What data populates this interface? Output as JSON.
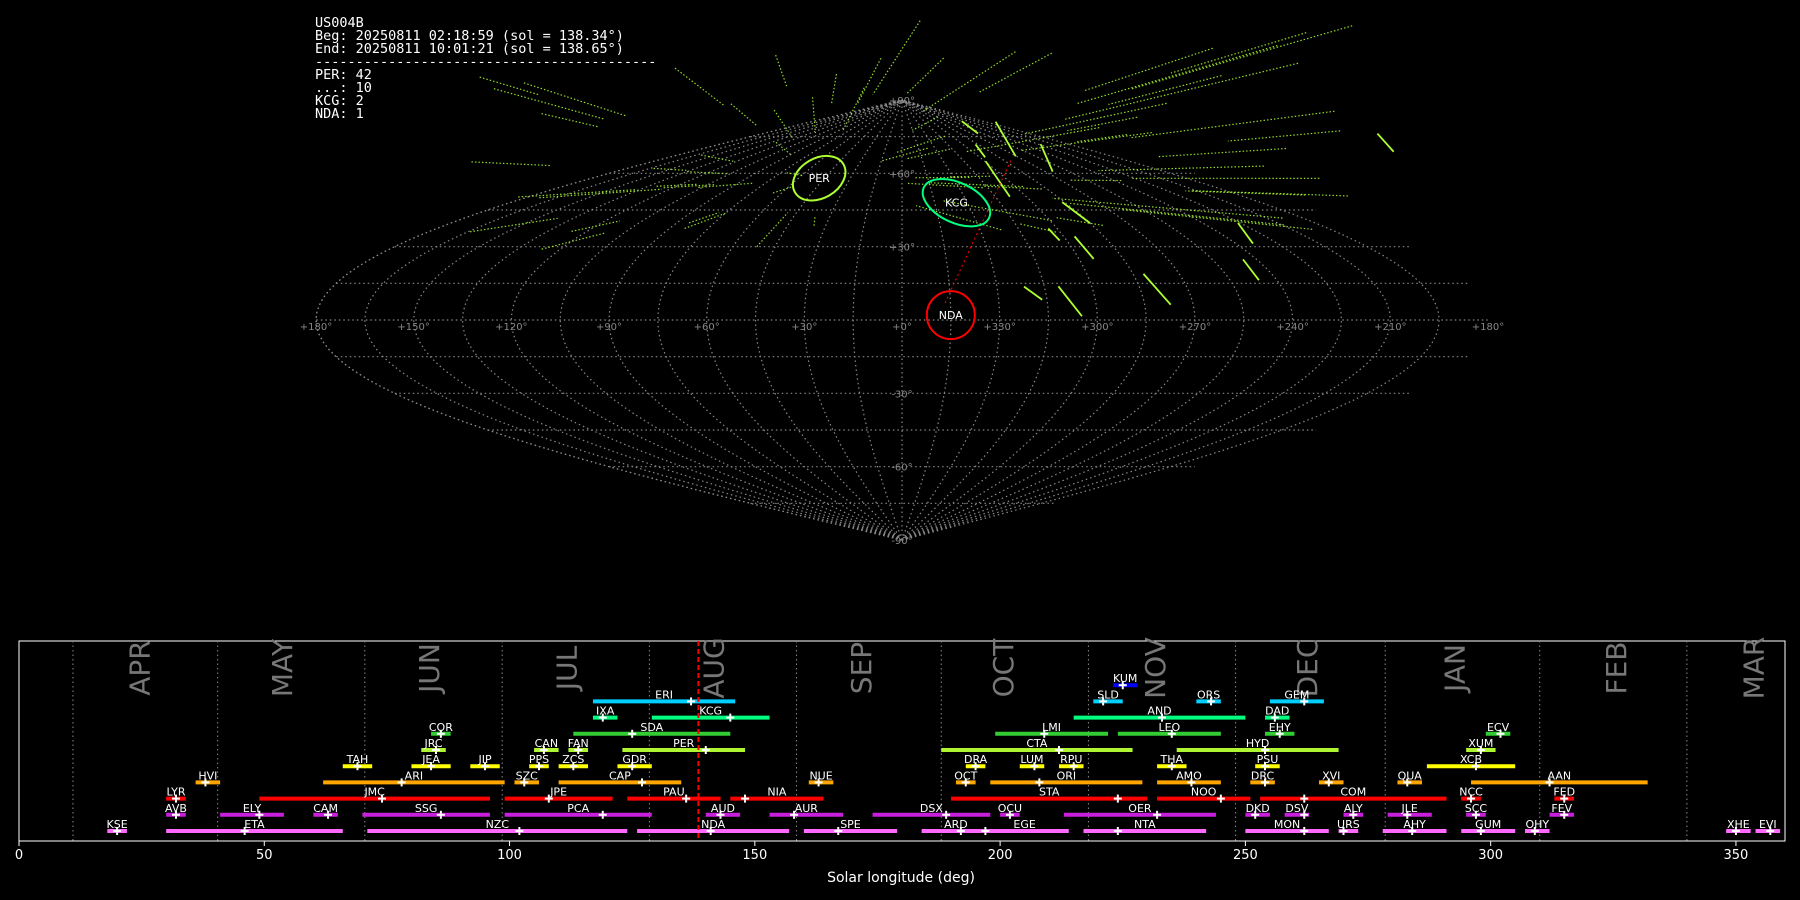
{
  "info": {
    "station": "US004B",
    "beg": "Beg: 20250811 02:18:59 (sol = 138.34°)",
    "end": "End: 20250811 10:01:21 (sol = 138.65°)",
    "separator": "------------------------------------------",
    "counts": [
      "PER: 42",
      "...: 10",
      "KCG: 2",
      "NDA: 1"
    ]
  },
  "colors": {
    "red": "#ff0000",
    "orange": "#ffa500",
    "yellow": "#ffff00",
    "yellowgreen": "#aef532",
    "green": "#32cd32",
    "springgreen": "#00ff7f",
    "cyan": "#00d0ff",
    "blue": "#0000ff",
    "purple": "#c71fdb",
    "pink": "#ff69ff",
    "violet": "#ee82ee",
    "grid": "#888888",
    "track": "#adff2f",
    "month_text": "#777777"
  },
  "chart_data": [
    {
      "type": "scatter",
      "projection": "sinusoidal",
      "lon_ticks": [
        180,
        150,
        120,
        90,
        60,
        30,
        0,
        330,
        300,
        270,
        240,
        210,
        180
      ],
      "lat_ticks": [
        90,
        60,
        30,
        -30,
        -60,
        -90
      ],
      "lon_tick_labels": [
        "+180°",
        "+150°",
        "+120°",
        "+90°",
        "+60°",
        "+30°",
        "+0°",
        "+330°",
        "+300°",
        "+270°",
        "+240°",
        "+210°",
        "+180°"
      ],
      "lat_tick_labels": [
        "+90°",
        "+60°",
        "+30°",
        "-30°",
        "-60°",
        "-90°"
      ],
      "radiants": [
        {
          "name": "PER",
          "lon": 48,
          "lat": 58,
          "color": "#adff2f"
        },
        {
          "name": "KCG",
          "lon": 335,
          "lat": 48,
          "color": "#00ff7f"
        },
        {
          "name": "NDA",
          "lon": 345,
          "lat": 2,
          "color": "#ff0000"
        }
      ]
    },
    {
      "type": "timeline",
      "xlabel": "Solar longitude (deg)",
      "xlim": [
        0,
        360
      ],
      "xticks": [
        0,
        50,
        100,
        150,
        200,
        250,
        300,
        350
      ],
      "current_sol": 138.5,
      "month_boundaries": [
        11,
        40.5,
        70.5,
        98.5,
        128.5,
        158.5,
        188,
        218,
        248,
        278.5,
        310,
        340
      ],
      "months": [
        {
          "name": "APR",
          "center": 25
        },
        {
          "name": "MAY",
          "center": 54
        },
        {
          "name": "JUN",
          "center": 84
        },
        {
          "name": "JUL",
          "center": 112
        },
        {
          "name": "AUG",
          "center": 142
        },
        {
          "name": "SEP",
          "center": 172
        },
        {
          "name": "OCT",
          "center": 201
        },
        {
          "name": "NOV",
          "center": 232
        },
        {
          "name": "DEC",
          "center": 263
        },
        {
          "name": "JAN",
          "center": 293
        },
        {
          "name": "FEB",
          "center": 326
        },
        {
          "name": "MAR",
          "center": 354
        }
      ],
      "showers": [
        {
          "code": "KUM",
          "row": 9,
          "start": 223,
          "end": 228,
          "peak": 225,
          "color": "blue"
        },
        {
          "code": "ERI",
          "row": 8,
          "start": 117,
          "end": 146,
          "peak": 137,
          "color": "cyan"
        },
        {
          "code": "SLD",
          "row": 8,
          "start": 219,
          "end": 225,
          "peak": 221,
          "color": "cyan"
        },
        {
          "code": "ORS",
          "row": 8,
          "start": 240,
          "end": 245,
          "peak": 243,
          "color": "cyan"
        },
        {
          "code": "GEM",
          "row": 8,
          "start": 255,
          "end": 266,
          "peak": 262,
          "color": "cyan"
        },
        {
          "code": "IXA",
          "row": 7,
          "start": 117,
          "end": 122,
          "peak": 119,
          "color": "springgreen"
        },
        {
          "code": "KCG",
          "row": 7,
          "start": 129,
          "end": 153,
          "peak": 145,
          "color": "springgreen"
        },
        {
          "code": "AND",
          "row": 7,
          "start": 215,
          "end": 250,
          "peak": 233,
          "color": "springgreen"
        },
        {
          "code": "DAD",
          "row": 7,
          "start": 254,
          "end": 259,
          "peak": 256,
          "color": "springgreen"
        },
        {
          "code": "COR",
          "row": 6,
          "start": 84,
          "end": 88,
          "peak": 86,
          "color": "green"
        },
        {
          "code": "SDA",
          "row": 6,
          "start": 113,
          "end": 145,
          "peak": 125,
          "color": "green"
        },
        {
          "code": "LMI",
          "row": 6,
          "start": 199,
          "end": 222,
          "peak": 209,
          "color": "green"
        },
        {
          "code": "LEO",
          "row": 6,
          "start": 224,
          "end": 245,
          "peak": 235,
          "color": "green"
        },
        {
          "code": "EHY",
          "row": 6,
          "start": 254,
          "end": 260,
          "peak": 257,
          "color": "green"
        },
        {
          "code": "ECV",
          "row": 6,
          "start": 299,
          "end": 304,
          "peak": 302,
          "color": "green"
        },
        {
          "code": "JRC",
          "row": 5,
          "start": 82,
          "end": 87,
          "peak": 85,
          "color": "yellowgreen"
        },
        {
          "code": "CAN",
          "row": 5,
          "start": 105,
          "end": 110,
          "peak": 107,
          "color": "yellowgreen"
        },
        {
          "code": "FAN",
          "row": 5,
          "start": 112,
          "end": 116,
          "peak": 114,
          "color": "yellowgreen"
        },
        {
          "code": "PER",
          "row": 5,
          "start": 123,
          "end": 148,
          "peak": 140,
          "color": "yellowgreen"
        },
        {
          "code": "CTA",
          "row": 5,
          "start": 188,
          "end": 227,
          "peak": 212,
          "color": "yellowgreen"
        },
        {
          "code": "HYD",
          "row": 5,
          "start": 236,
          "end": 269,
          "peak": 254,
          "color": "yellowgreen"
        },
        {
          "code": "XUM",
          "row": 5,
          "start": 295,
          "end": 301,
          "peak": 298,
          "color": "yellowgreen"
        },
        {
          "code": "TAH",
          "row": 4,
          "start": 66,
          "end": 72,
          "peak": 69,
          "color": "yellow"
        },
        {
          "code": "JEA",
          "row": 4,
          "start": 80,
          "end": 88,
          "peak": 84,
          "color": "yellow"
        },
        {
          "code": "JIP",
          "row": 4,
          "start": 92,
          "end": 98,
          "peak": 95,
          "color": "yellow"
        },
        {
          "code": "PPS",
          "row": 4,
          "start": 104,
          "end": 108,
          "peak": 106,
          "color": "yellow"
        },
        {
          "code": "ZCS",
          "row": 4,
          "start": 110,
          "end": 116,
          "peak": 113,
          "color": "yellow"
        },
        {
          "code": "GDR",
          "row": 4,
          "start": 122,
          "end": 129,
          "peak": 125,
          "color": "yellow"
        },
        {
          "code": "DRA",
          "row": 4,
          "start": 193,
          "end": 197,
          "peak": 195,
          "color": "yellow"
        },
        {
          "code": "LUM",
          "row": 4,
          "start": 204,
          "end": 209,
          "peak": 207,
          "color": "yellow"
        },
        {
          "code": "RPU",
          "row": 4,
          "start": 212,
          "end": 217,
          "peak": 215,
          "color": "yellow"
        },
        {
          "code": "THA",
          "row": 4,
          "start": 232,
          "end": 238,
          "peak": 235,
          "color": "yellow"
        },
        {
          "code": "PSU",
          "row": 4,
          "start": 252,
          "end": 257,
          "peak": 254,
          "color": "yellow"
        },
        {
          "code": "XCB",
          "row": 4,
          "start": 287,
          "end": 305,
          "peak": 297,
          "color": "yellow"
        },
        {
          "code": "HVI",
          "row": 3,
          "start": 36,
          "end": 41,
          "peak": 38,
          "color": "orange"
        },
        {
          "code": "ARI",
          "row": 3,
          "start": 62,
          "end": 99,
          "peak": 78,
          "color": "orange"
        },
        {
          "code": "SZC",
          "row": 3,
          "start": 101,
          "end": 106,
          "peak": 103,
          "color": "orange"
        },
        {
          "code": "CAP",
          "row": 3,
          "start": 110,
          "end": 135,
          "peak": 127,
          "color": "orange"
        },
        {
          "code": "NUE",
          "row": 3,
          "start": 161,
          "end": 166,
          "peak": 163,
          "color": "orange"
        },
        {
          "code": "OCT",
          "row": 3,
          "start": 191,
          "end": 195,
          "peak": 193,
          "color": "orange"
        },
        {
          "code": "ORI",
          "row": 3,
          "start": 198,
          "end": 229,
          "peak": 208,
          "color": "orange"
        },
        {
          "code": "AMO",
          "row": 3,
          "start": 232,
          "end": 245,
          "peak": 239,
          "color": "orange"
        },
        {
          "code": "DRC",
          "row": 3,
          "start": 251,
          "end": 256,
          "peak": 254,
          "color": "orange"
        },
        {
          "code": "XVI",
          "row": 3,
          "start": 265,
          "end": 270,
          "peak": 267,
          "color": "orange"
        },
        {
          "code": "QUA",
          "row": 3,
          "start": 281,
          "end": 286,
          "peak": 283,
          "color": "orange"
        },
        {
          "code": "AAN",
          "row": 3,
          "start": 296,
          "end": 332,
          "peak": 312,
          "color": "orange"
        },
        {
          "code": "LYR",
          "row": 2,
          "start": 30,
          "end": 34,
          "peak": 32,
          "color": "red"
        },
        {
          "code": "JMC",
          "row": 2,
          "start": 49,
          "end": 96,
          "peak": 74,
          "color": "red"
        },
        {
          "code": "JPE",
          "row": 2,
          "start": 99,
          "end": 121,
          "peak": 108,
          "color": "red"
        },
        {
          "code": "PAU",
          "row": 2,
          "start": 124,
          "end": 143,
          "peak": 136,
          "color": "red"
        },
        {
          "code": "NIA",
          "row": 2,
          "start": 145,
          "end": 164,
          "peak": 148,
          "color": "red"
        },
        {
          "code": "STA",
          "row": 2,
          "start": 190,
          "end": 230,
          "peak": 224,
          "color": "red"
        },
        {
          "code": "NOO",
          "row": 2,
          "start": 232,
          "end": 251,
          "peak": 245,
          "color": "red"
        },
        {
          "code": "COM",
          "row": 2,
          "start": 253,
          "end": 291,
          "peak": 262,
          "color": "red"
        },
        {
          "code": "NCC",
          "row": 2,
          "start": 294,
          "end": 298,
          "peak": 296,
          "color": "red"
        },
        {
          "code": "FED",
          "row": 2,
          "start": 313,
          "end": 317,
          "peak": 315,
          "color": "red"
        },
        {
          "code": "AVB",
          "row": 1,
          "start": 30,
          "end": 34,
          "peak": 32,
          "color": "purple"
        },
        {
          "code": "ELY",
          "row": 1,
          "start": 41,
          "end": 54,
          "peak": 49,
          "color": "purple"
        },
        {
          "code": "CAM",
          "row": 1,
          "start": 60,
          "end": 65,
          "peak": 63,
          "color": "purple"
        },
        {
          "code": "SSG",
          "row": 1,
          "start": 70,
          "end": 96,
          "peak": 86,
          "color": "purple"
        },
        {
          "code": "PCA",
          "row": 1,
          "start": 99,
          "end": 129,
          "peak": 119,
          "color": "purple"
        },
        {
          "code": "AUD",
          "row": 1,
          "start": 140,
          "end": 147,
          "peak": 143,
          "color": "purple"
        },
        {
          "code": "AUR",
          "row": 1,
          "start": 153,
          "end": 168,
          "peak": 158,
          "color": "purple"
        },
        {
          "code": "DSX",
          "row": 1,
          "start": 174,
          "end": 198,
          "peak": 189,
          "color": "purple"
        },
        {
          "code": "OCU",
          "row": 1,
          "start": 200,
          "end": 204,
          "peak": 202,
          "color": "purple"
        },
        {
          "code": "OER",
          "row": 1,
          "start": 213,
          "end": 244,
          "peak": 232,
          "color": "purple"
        },
        {
          "code": "DKD",
          "row": 1,
          "start": 250,
          "end": 255,
          "peak": 252,
          "color": "purple"
        },
        {
          "code": "DSV",
          "row": 1,
          "start": 258,
          "end": 263,
          "peak": 262,
          "color": "purple"
        },
        {
          "code": "ALY",
          "row": 1,
          "start": 270,
          "end": 274,
          "peak": 272,
          "color": "purple"
        },
        {
          "code": "JLE",
          "row": 1,
          "start": 279,
          "end": 288,
          "peak": 283,
          "color": "purple"
        },
        {
          "code": "SCC",
          "row": 1,
          "start": 295,
          "end": 299,
          "peak": 297,
          "color": "purple"
        },
        {
          "code": "FEV",
          "row": 1,
          "start": 312,
          "end": 317,
          "peak": 315,
          "color": "purple"
        },
        {
          "code": "KSE",
          "row": 0,
          "start": 18,
          "end": 22,
          "peak": 20,
          "color": "pink"
        },
        {
          "code": "ETA",
          "row": 0,
          "start": 30,
          "end": 66,
          "peak": 46,
          "color": "pink"
        },
        {
          "code": "NZC",
          "row": 0,
          "start": 71,
          "end": 124,
          "peak": 102,
          "color": "pink"
        },
        {
          "code": "NDA",
          "row": 0,
          "start": 126,
          "end": 157,
          "peak": 141,
          "color": "pink"
        },
        {
          "code": "SPE",
          "row": 0,
          "start": 160,
          "end": 179,
          "peak": 167,
          "color": "pink"
        },
        {
          "code": "ARD",
          "row": 0,
          "start": 184,
          "end": 198,
          "peak": 192,
          "color": "pink"
        },
        {
          "code": "EGE",
          "row": 0,
          "start": 196,
          "end": 214,
          "peak": 197,
          "color": "pink"
        },
        {
          "code": "NTA",
          "row": 0,
          "start": 217,
          "end": 242,
          "peak": 224,
          "color": "pink"
        },
        {
          "code": "MON",
          "row": 0,
          "start": 250,
          "end": 267,
          "peak": 262,
          "color": "pink"
        },
        {
          "code": "URS",
          "row": 0,
          "start": 269,
          "end": 273,
          "peak": 270,
          "color": "pink"
        },
        {
          "code": "AHY",
          "row": 0,
          "start": 278,
          "end": 291,
          "peak": 284,
          "color": "pink"
        },
        {
          "code": "GUM",
          "row": 0,
          "start": 294,
          "end": 305,
          "peak": 298,
          "color": "pink"
        },
        {
          "code": "OHY",
          "row": 0,
          "start": 307,
          "end": 312,
          "peak": 309,
          "color": "pink"
        },
        {
          "code": "XHE",
          "row": 0,
          "start": 348,
          "end": 353,
          "peak": 350,
          "color": "pink"
        },
        {
          "code": "EVI",
          "row": 0,
          "start": 354,
          "end": 359,
          "peak": 357,
          "color": "pink"
        }
      ]
    }
  ]
}
